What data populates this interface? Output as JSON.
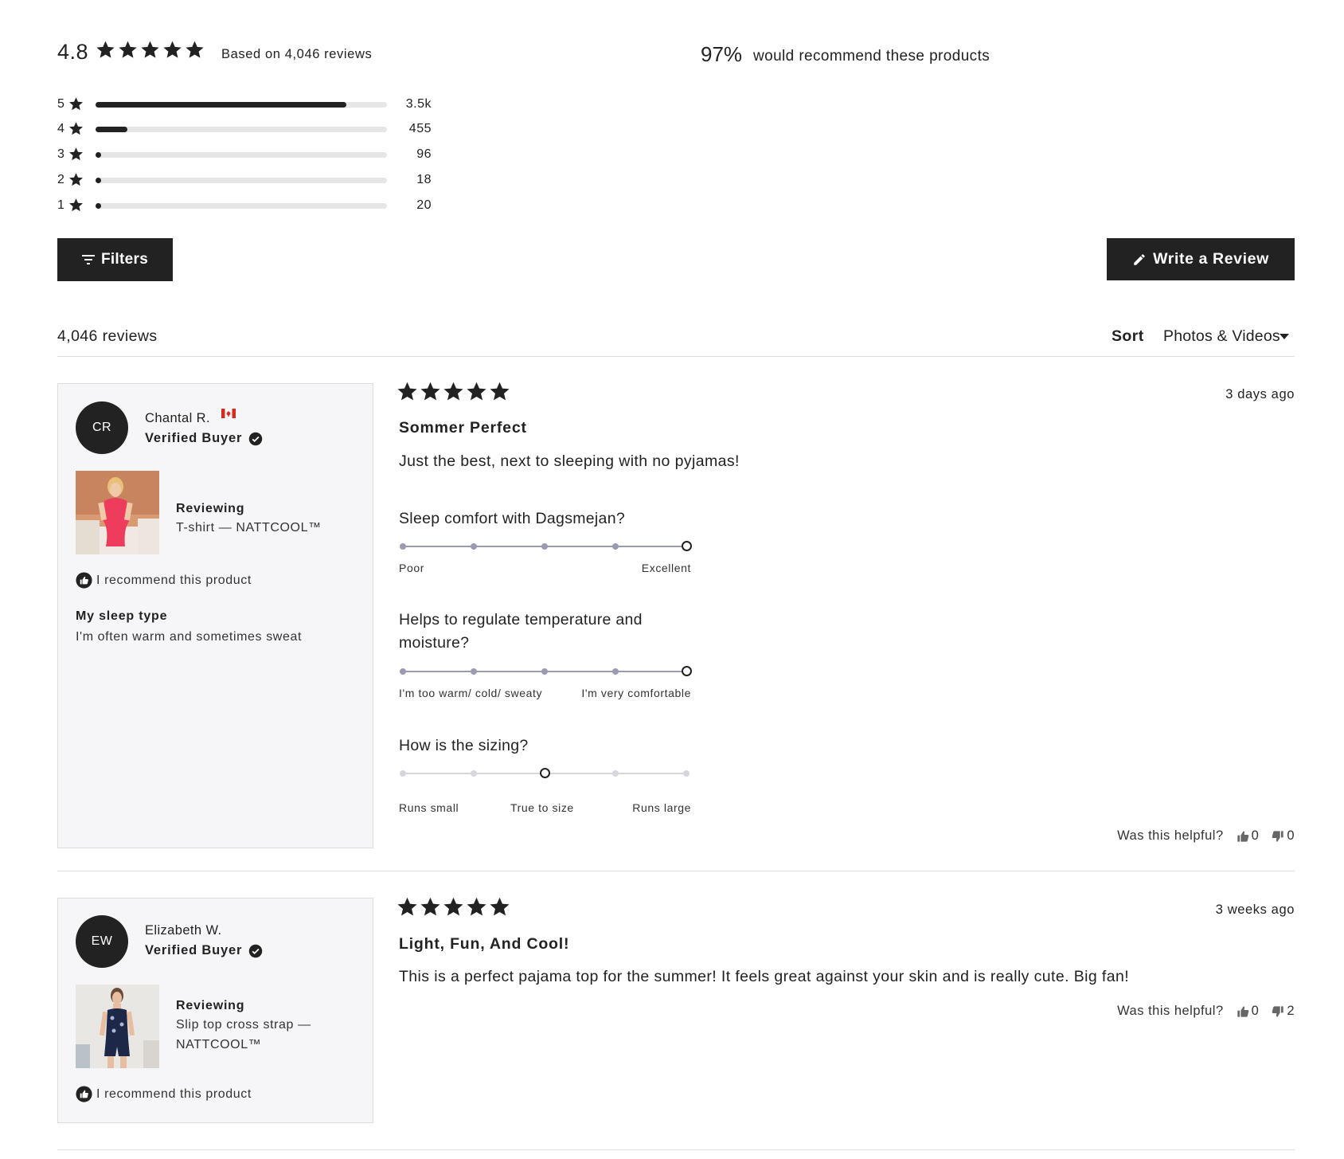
{
  "summary": {
    "average_rating": "4.8",
    "average_stars": 5,
    "based_on": "Based on 4,046 reviews",
    "recommend_percent": "97%",
    "recommend_text": "would recommend these products",
    "histogram": [
      {
        "stars": "5",
        "count": "3.5k",
        "fraction": 0.86
      },
      {
        "stars": "4",
        "count": "455",
        "fraction": 0.11
      },
      {
        "stars": "3",
        "count": "96",
        "fraction": 0.02
      },
      {
        "stars": "2",
        "count": "18",
        "fraction": 0.005
      },
      {
        "stars": "1",
        "count": "20",
        "fraction": 0.005
      }
    ]
  },
  "toolbar": {
    "filters_label": "Filters",
    "write_review_label": "Write a Review",
    "review_count": "4,046 reviews",
    "sort_label": "Sort",
    "sort_value": "Photos & Videos"
  },
  "reviews": [
    {
      "initials": "CR",
      "author": "Chantal R.",
      "verified": "Verified Buyer",
      "reviewing_label": "Reviewing",
      "product": "T-shirt — NATTCOOL™",
      "recommend": "I recommend this product",
      "sleep_type_label": "My sleep type",
      "sleep_type_value": "I'm often warm and sometimes sweat",
      "stars": 5,
      "date": "3 days ago",
      "title": "Sommer Perfect",
      "text": "Just the best, next to sleeping with no pyjamas!",
      "questions": [
        {
          "label": "Sleep comfort with Dagsmejan?",
          "left": "Poor",
          "right": "Excellent",
          "value": 5
        },
        {
          "label": "Helps to regulate temperature and moisture?",
          "left": "I'm too warm/ cold/ sweaty",
          "right": "I'm very comfortable",
          "value": 5
        },
        {
          "label": "How is the sizing?",
          "left": "Runs small",
          "middle": "True to size",
          "right": "Runs large",
          "value": 3
        }
      ],
      "helpful_label": "Was this helpful?",
      "up_votes": "0",
      "down_votes": "0"
    },
    {
      "initials": "EW",
      "author": "Elizabeth W.",
      "verified": "Verified Buyer",
      "reviewing_label": "Reviewing",
      "product": "Slip top cross strap — NATTCOOL™",
      "recommend": "I recommend this product",
      "stars": 5,
      "date": "3 weeks ago",
      "title": "Light, Fun, And Cool!",
      "text": "This is a perfect pajama top for the summer! It feels great against your skin and is really cute. Big fan!",
      "helpful_label": "Was this helpful?",
      "up_votes": "0",
      "down_votes": "2"
    }
  ],
  "colors": {
    "primary": "#222222",
    "panel_bg": "#f6f6f8",
    "track": "#e6e6e6",
    "scale_line": "#9a9ab0",
    "scale_line_light": "#d6d6dc"
  }
}
